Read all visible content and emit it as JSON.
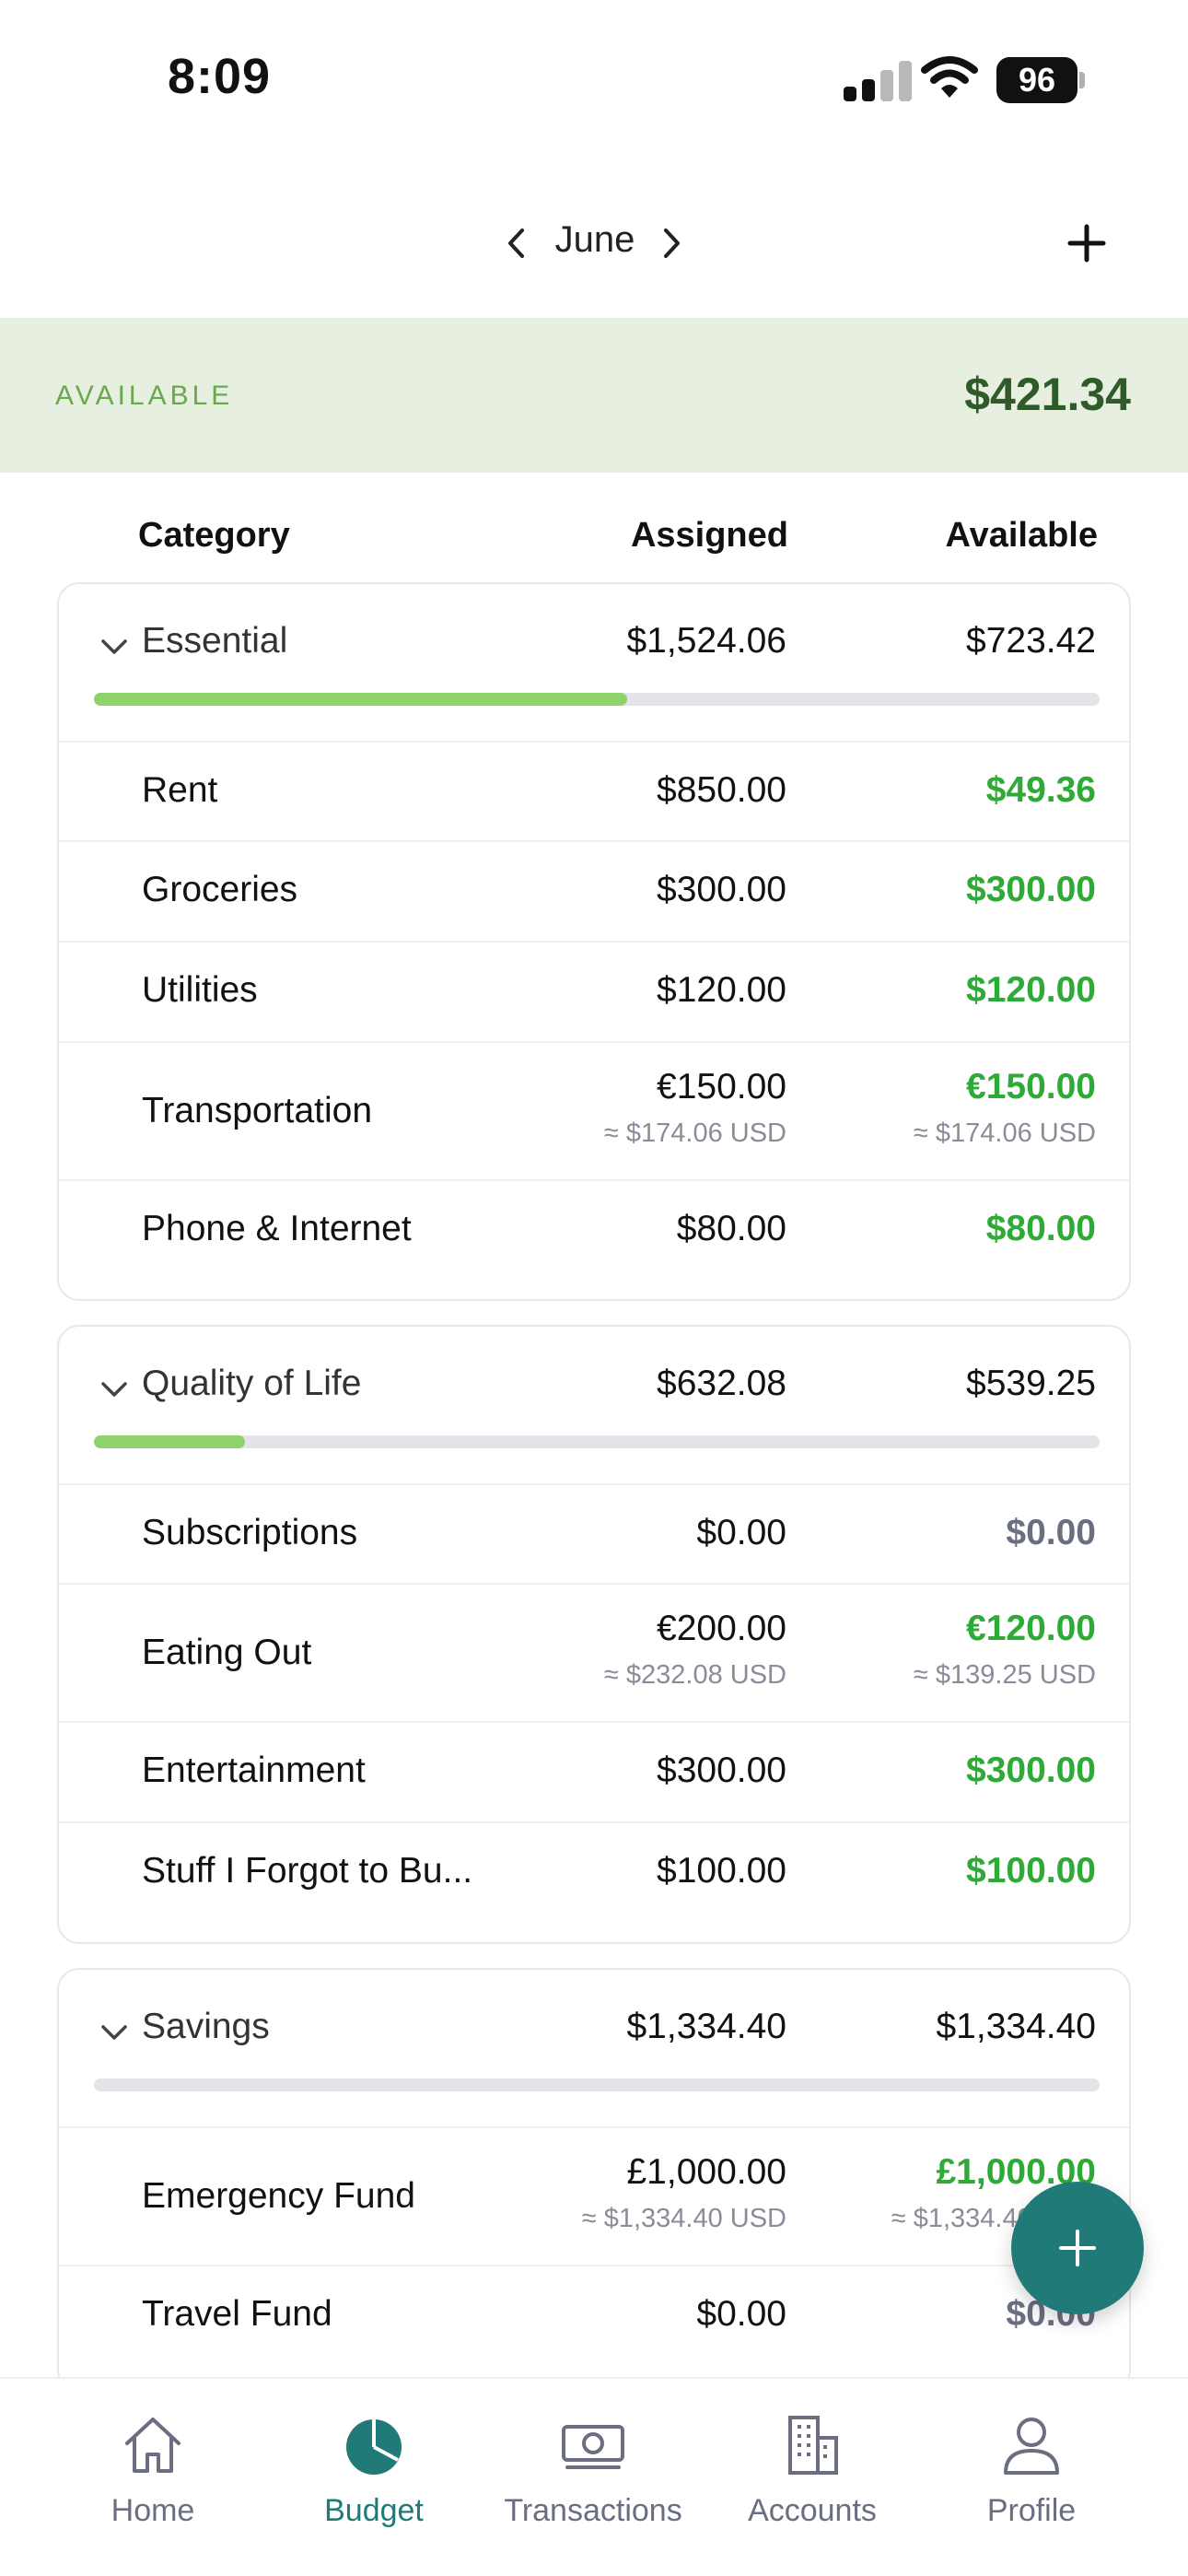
{
  "status_bar": {
    "time": "8:09",
    "battery": "96"
  },
  "header": {
    "month": "June"
  },
  "available": {
    "label": "AVAILABLE",
    "amount": "$421.34"
  },
  "columns": {
    "category": "Category",
    "assigned": "Assigned",
    "available": "Available"
  },
  "groups": [
    {
      "name": "Essential",
      "assigned": "$1,524.06",
      "available": "$723.42",
      "progress": 0.53,
      "rows": [
        {
          "name": "Rent",
          "assigned": "$850.00",
          "available": "$49.36"
        },
        {
          "name": "Groceries",
          "assigned": "$300.00",
          "available": "$300.00"
        },
        {
          "name": "Utilities",
          "assigned": "$120.00",
          "available": "$120.00"
        },
        {
          "name": "Transportation",
          "assigned": "€150.00",
          "assigned_sub": "≈ $174.06 USD",
          "available": "€150.00",
          "available_sub": "≈ $174.06 USD"
        },
        {
          "name": "Phone & Internet",
          "assigned": "$80.00",
          "available": "$80.00"
        }
      ]
    },
    {
      "name": "Quality of Life",
      "assigned": "$632.08",
      "available": "$539.25",
      "progress": 0.15,
      "rows": [
        {
          "name": "Subscriptions",
          "assigned": "$0.00",
          "available": "$0.00"
        },
        {
          "name": "Eating Out",
          "assigned": "€200.00",
          "assigned_sub": "≈ $232.08 USD",
          "available": "€120.00",
          "available_sub": "≈ $139.25 USD"
        },
        {
          "name": "Entertainment",
          "assigned": "$300.00",
          "available": "$300.00"
        },
        {
          "name": "Stuff I Forgot to Bu...",
          "assigned": "$100.00",
          "available": "$100.00"
        }
      ]
    },
    {
      "name": "Savings",
      "assigned": "$1,334.40",
      "available": "$1,334.40",
      "progress": 0,
      "rows": [
        {
          "name": "Emergency Fund",
          "assigned": "£1,000.00",
          "assigned_sub": "≈ $1,334.40 USD",
          "available": "£1,000.00",
          "available_sub": "≈ $1,334.40 USD"
        },
        {
          "name": "Travel Fund",
          "assigned": "$0.00",
          "available": "$0.00"
        }
      ]
    }
  ],
  "tabs": [
    {
      "label": "Home",
      "icon": "home-icon"
    },
    {
      "label": "Budget",
      "icon": "pie-chart-icon",
      "active": true
    },
    {
      "label": "Transactions",
      "icon": "cash-icon"
    },
    {
      "label": "Accounts",
      "icon": "building-icon"
    },
    {
      "label": "Profile",
      "icon": "person-icon"
    }
  ],
  "colors": {
    "accent": "#1f7a78",
    "positive": "#2eaa36",
    "zero": "#6b6e80",
    "banner_bg": "#e7efe0",
    "progress_fill": "#8fd16a"
  }
}
